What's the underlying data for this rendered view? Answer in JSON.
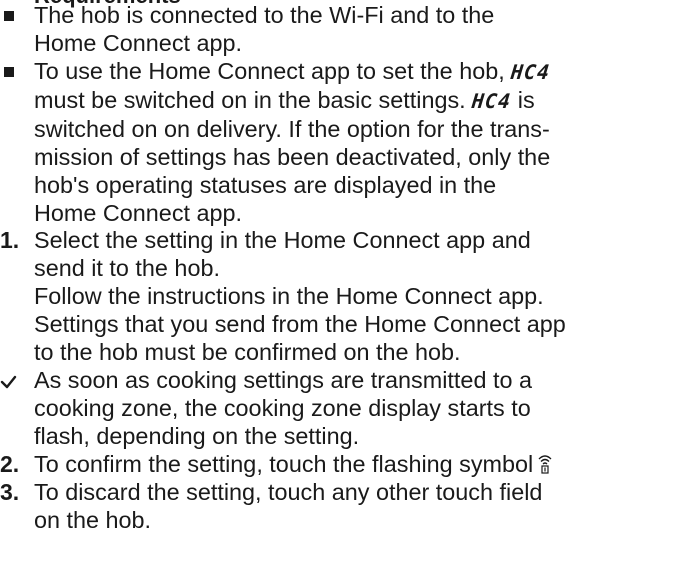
{
  "heading": "Requirements",
  "requirements": [
    {
      "lines": [
        "The hob is connected to the Wi-Fi and to the",
        "Home Connect app."
      ]
    },
    {
      "line1_a": "To use the Home Connect app to set the hob,",
      "line1_code": "HC4",
      "line2_a": "must be switched on in the basic settings.",
      "line2_code": "HC4",
      "line2_b": "is",
      "lines_rest": [
        "switched on on delivery. If the option for the trans-",
        "mission of settings has been deactivated, only the",
        "hob's operating statuses are displayed in the",
        "Home Connect app."
      ]
    }
  ],
  "steps": [
    {
      "number": "1.",
      "lines": [
        "Select the setting in the Home Connect app and",
        "send it to the hob.",
        "Follow the instructions in the Home Connect app.",
        "Settings that you send from the Home Connect app",
        "to the hob must be confirmed on the hob."
      ]
    },
    {
      "number": "✔",
      "lines": [
        "As soon as cooking settings are transmitted to a",
        "cooking zone, the cooking zone display starts to",
        "flash, depending on the setting."
      ]
    },
    {
      "number": "2.",
      "text": "To confirm the setting, touch the flashing symbol",
      "icon": "remote-start-icon"
    },
    {
      "number": "3.",
      "lines": [
        "To discard the setting, touch any other touch field",
        "on the hob."
      ]
    }
  ]
}
